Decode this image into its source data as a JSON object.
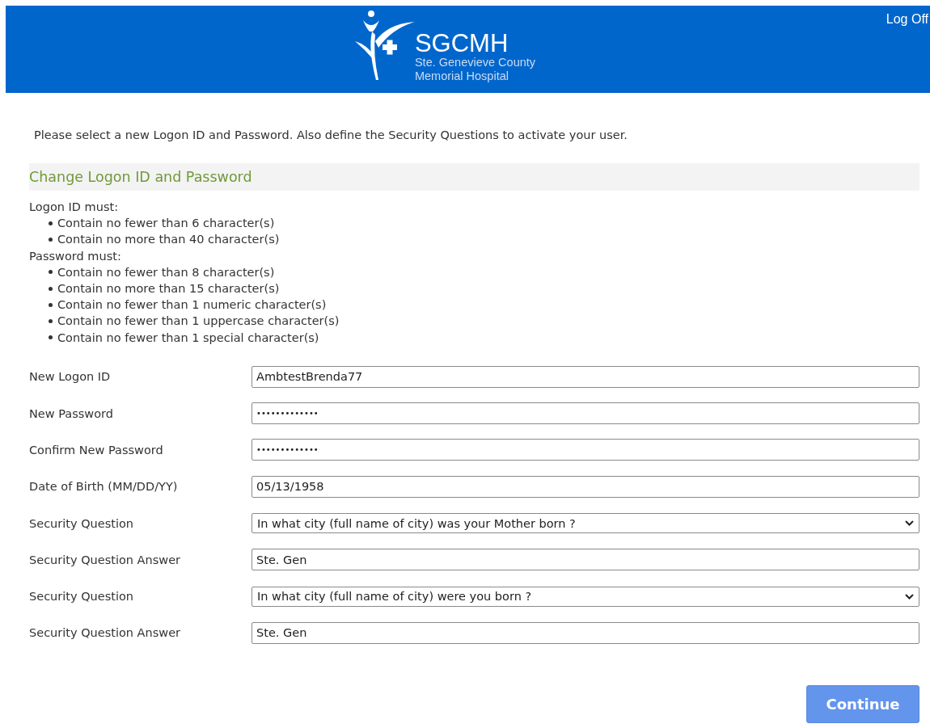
{
  "header": {
    "logo": {
      "name": "SGCMH",
      "subtitle_lines": [
        "Ste. Genevieve County",
        "Memorial Hospital"
      ]
    },
    "log_off": "Log Off"
  },
  "intro": "Please select a new Logon ID and Password. Also define the Security Questions to activate your user.",
  "section_title": "Change Logon ID and Password",
  "rule_groups": [
    {
      "heading": "Logon ID must:",
      "rules": [
        "Contain no fewer than 6 character(s)",
        "Contain no more than 40 character(s)"
      ]
    },
    {
      "heading": "Password must:",
      "rules": [
        "Contain no fewer than 8 character(s)",
        "Contain no more than 15 character(s)",
        "Contain no fewer than 1 numeric character(s)",
        "Contain no fewer than 1 uppercase character(s)",
        "Contain no fewer than 1 special character(s)"
      ]
    }
  ],
  "fields": [
    {
      "kind": "text",
      "label": "New Logon ID",
      "value": "AmbtestBrenda77"
    },
    {
      "kind": "password",
      "label": "New Password",
      "value": "•••••••••••••"
    },
    {
      "kind": "password",
      "label": "Confirm New Password",
      "value": "•••••••••••••"
    },
    {
      "kind": "text",
      "label": "Date of Birth (MM/DD/YY)",
      "value": "05/13/1958"
    },
    {
      "kind": "select",
      "label": "Security Question",
      "value": "In what city (full name of city) was your Mother born ?"
    },
    {
      "kind": "text",
      "label": "Security Question Answer",
      "value": "Ste. Gen"
    },
    {
      "kind": "select",
      "label": "Security Question",
      "value": "In what city (full name of city) were you born ?"
    },
    {
      "kind": "text",
      "label": "Security Question Answer",
      "value": "Ste. Gen"
    }
  ],
  "continue_button": "Continue"
}
